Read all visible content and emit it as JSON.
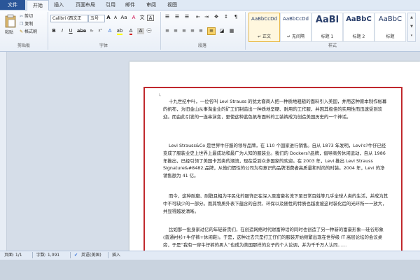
{
  "tabs": [
    "文件",
    "开始",
    "插入",
    "页面布局",
    "引用",
    "邮件",
    "审阅",
    "视图"
  ],
  "clipboard": {
    "paste": "粘贴",
    "cut": "剪切",
    "copy": "复制",
    "format_painter": "格式刷",
    "group": "剪贴板"
  },
  "font": {
    "name": "Calibri (西文正",
    "size": "五号",
    "group": "字体"
  },
  "paragraph": {
    "group": "段落"
  },
  "styles": {
    "group": "样式",
    "items": [
      {
        "sample": "AaBbCcDd",
        "name": "↵ 正文"
      },
      {
        "sample": "AaBbCcDd",
        "name": "↵ 无间隔"
      },
      {
        "sample": "AaBl",
        "name": "标题 1"
      },
      {
        "sample": "AaBbC",
        "name": "标题 2"
      },
      {
        "sample": "AaBbC",
        "name": "标题"
      }
    ]
  },
  "document": {
    "paragraphs": [
      "十九世纪中叶，一位名叫 Levi Strauss 的犹太裔商人把一种质地粗糙的面料引入美国，并用这种原本制作帐幕的帆布，为旧金山从事淘金业的矿工们制造出一种质地坚硬、耐用的工作服，并因其极佳的实用性而迅速受到欢迎。而由此引发的一连串演变，更使这种蓝色帆布面料的工装裤成为创造美国历史的一个神话。",
      "Levi Strauss&Co 是世界牛仔服的领导品牌，在 110 个国家进行销售。自从 1873 年发明，Levi's?牛仔已经变成了服装业史上世界上最成功和最广为人知的服装业。我们的 Dockers?品牌，倡导商务休闲运动，自从 1986 年推出，已经引领了美国卡其类的潮流，现在受到众多国家的欢迎。在 2003 年，Levi 推出 Levi Strauss Signature&#8482;品牌，从他们惯性的公司为有意识的品牌消费者高质量和时尚的时装。2004 年，Levi 的净销售额为 41 亿。",
      "而今，这种耐磨、耐脏且粗为平民化的服饰正在深入至富豪名流下至日常百姓等几乎全球人类的生活，并成为其中不可缺少的一部分。而其物质外表下蕴含的自然、环保以及随性的特质也越发被这时装化后的光环所一一放大，并显得越发清晰。",
      "比如那一批身家过亿的年轻新贵们，在创造网络时代财富神话的同时也创造了另一种新的富豪形象—硅谷形象(普通衬衫+牛仔裤+休闲鞋)。于是，这种过去只是打工仔们的服装开始频繁出现在世界级 IT 高层论坛的会议桌旁，于是“我有一穿牛仔裤的男人”也成为美国那样的女子的个人论调，并为千千万人认同……",
      "与此同时，当这种“世纪之裤”的服装有逐步上升的趋势，下至普通阶层，当然更其自"
    ]
  },
  "status": {
    "page": "页面: 1/1",
    "words": "字数: 1,091",
    "language": "英语(美国)",
    "mode": "插入"
  }
}
